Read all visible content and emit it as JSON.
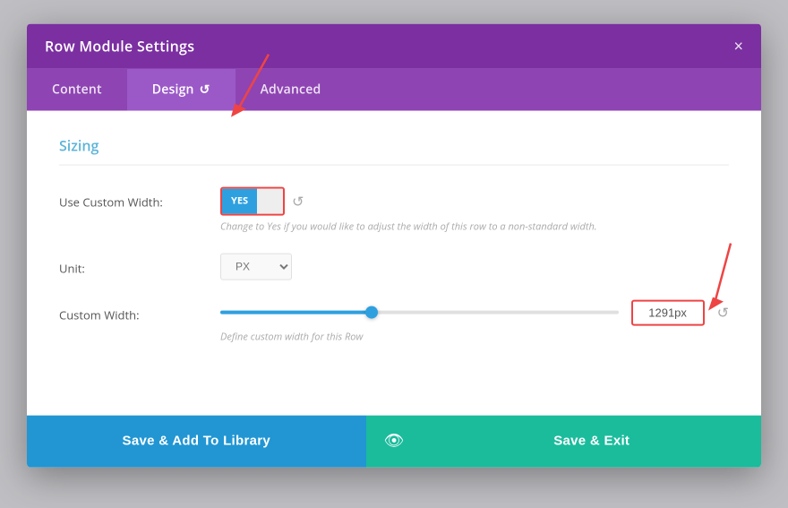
{
  "modal": {
    "title": "Row Module Settings",
    "close_label": "×",
    "tabs": [
      {
        "id": "content",
        "label": "Content",
        "active": false
      },
      {
        "id": "design",
        "label": "Design",
        "active": true,
        "icon": "↺"
      },
      {
        "id": "advanced",
        "label": "Advanced",
        "active": false
      }
    ],
    "sections": [
      {
        "id": "sizing",
        "title": "Sizing",
        "fields": [
          {
            "id": "use-custom-width",
            "label": "Use Custom Width:",
            "type": "toggle",
            "value": "YES",
            "helper": "Change to Yes if you would like to adjust the width of this row to a non-standard width."
          },
          {
            "id": "unit",
            "label": "Unit:",
            "type": "select",
            "value": "PX"
          },
          {
            "id": "custom-width",
            "label": "Custom Width:",
            "type": "slider",
            "value": "1291px",
            "helper": "Define custom width for this Row",
            "slider_percent": 38
          }
        ]
      }
    ],
    "footer": {
      "save_library_label": "Save & Add To Library",
      "eye_icon": "👁",
      "save_exit_label": "Save & Exit"
    }
  }
}
